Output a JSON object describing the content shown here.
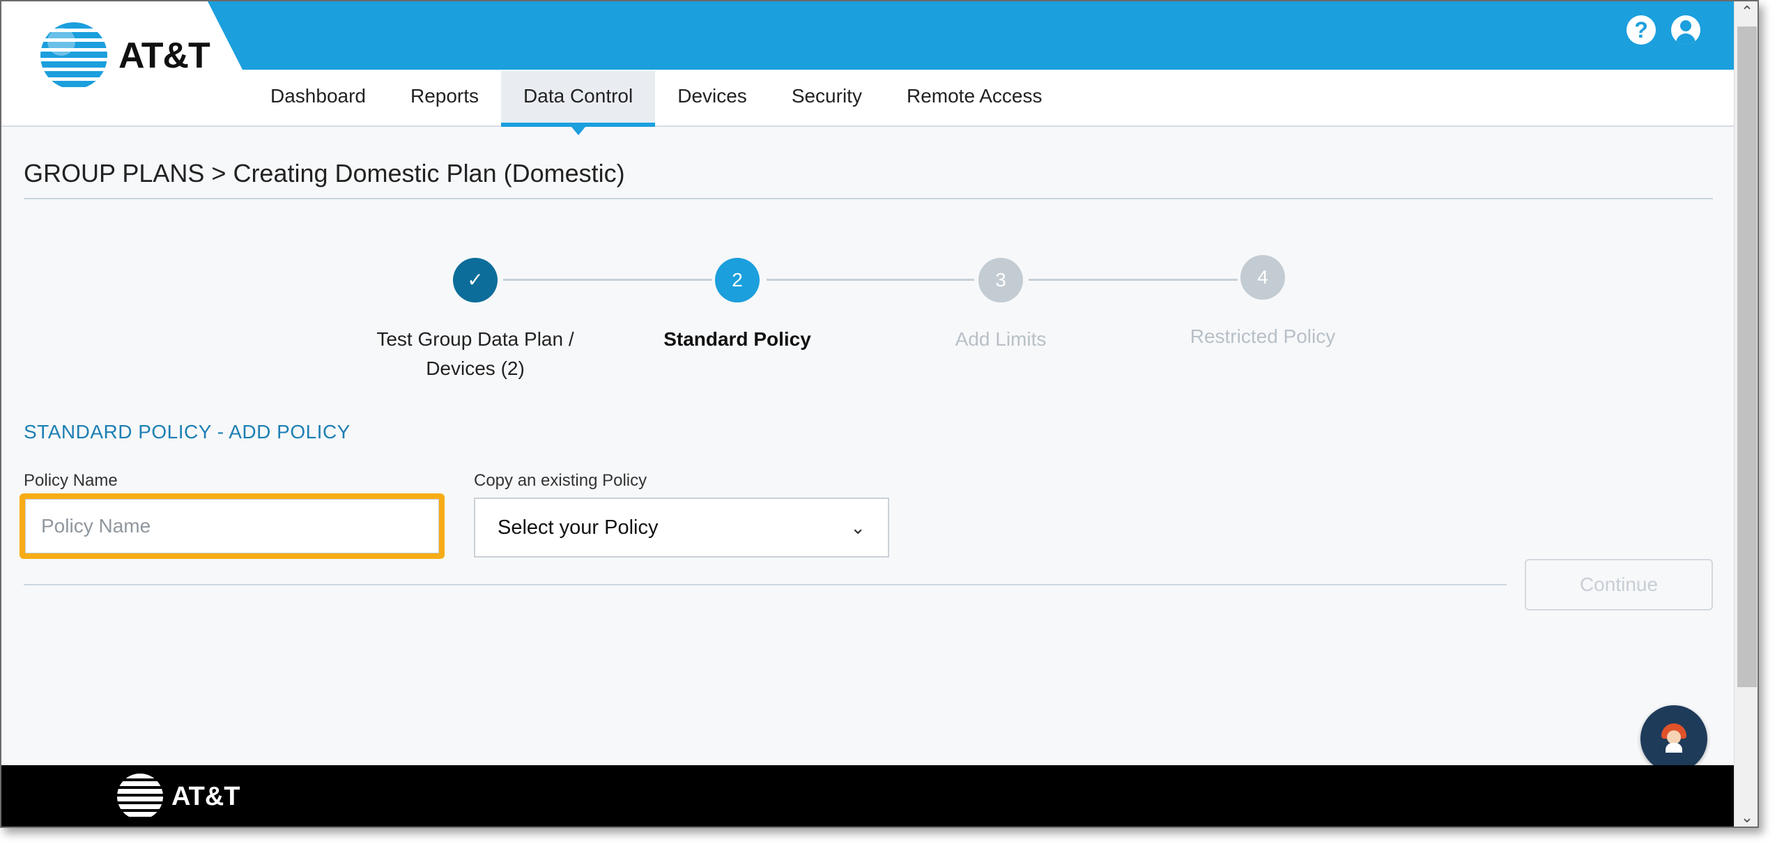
{
  "header": {
    "brand": "AT&T",
    "help_icon": "question-circle-icon",
    "user_icon": "user-circle-icon",
    "nav": [
      {
        "label": "Dashboard",
        "active": false
      },
      {
        "label": "Reports",
        "active": false
      },
      {
        "label": "Data Control",
        "active": true
      },
      {
        "label": "Devices",
        "active": false
      },
      {
        "label": "Security",
        "active": false
      },
      {
        "label": "Remote Access",
        "active": false
      }
    ]
  },
  "breadcrumb": "GROUP PLANS > Creating Domestic Plan (Domestic)",
  "stepper": {
    "steps": [
      {
        "marker": "✓",
        "label": "Test Group Data Plan / Devices (2)",
        "state": "done"
      },
      {
        "marker": "2",
        "label": "Standard Policy",
        "state": "active"
      },
      {
        "marker": "3",
        "label": "Add Limits",
        "state": "future"
      },
      {
        "marker": "4",
        "label": "Restricted Policy",
        "state": "future"
      }
    ]
  },
  "form": {
    "section_title": "STANDARD POLICY - ADD POLICY",
    "policy_name_label": "Policy Name",
    "policy_name_placeholder": "Policy Name",
    "policy_name_value": "",
    "copy_label": "Copy an existing Policy",
    "copy_selected": "Select your Policy",
    "continue_label": "Continue"
  },
  "footer": {
    "brand": "AT&T"
  },
  "colors": {
    "brand_blue": "#1b9fdd",
    "step_done": "#0d6d9a",
    "highlight": "#f7ac16",
    "footer_bg": "#000000"
  }
}
